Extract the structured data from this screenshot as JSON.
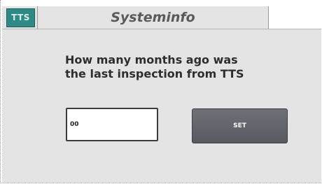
{
  "header": {
    "logo_text": "TTS",
    "title": "Systeminfo"
  },
  "main": {
    "question_line1": "How many months ago was",
    "question_line2": "the last inspection from TTS",
    "months_value": "00",
    "set_label": "SET"
  },
  "colors": {
    "panel_background": "#e4e4e4",
    "logo_background": "#2f8a86",
    "button_background": "#62646b"
  }
}
